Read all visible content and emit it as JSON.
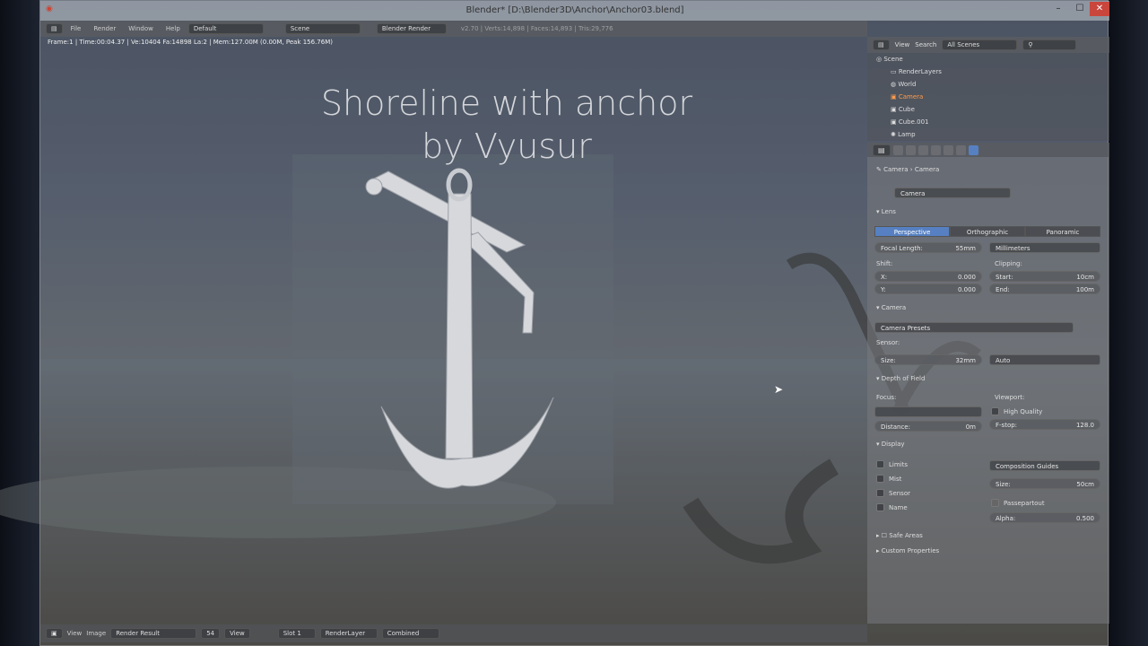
{
  "window": {
    "title": "Blender* [D:\\Blender3D\\Anchor\\Anchor03.blend]",
    "controls": [
      "–",
      "☐",
      "✕"
    ]
  },
  "menubar": {
    "menus": [
      "File",
      "Render",
      "Window",
      "Help"
    ],
    "layout": "Default",
    "scene": "Scene",
    "engine": "Blender Render",
    "stats": "v2.70 | Verts:14,898 | Faces:14,893 | Tris:29,776"
  },
  "viewport": {
    "info": "Frame:1 | Time:00:04.37 | Ve:10404 Fa:14898 La:2 | Mem:127.00M (0.00M, Peak 156.76M)",
    "overlay_line1": "Shoreline with anchor",
    "overlay_line2": "by Vyusur"
  },
  "bottombar": {
    "view": "View",
    "image": "Image",
    "image_name": "Render Result",
    "frame_num": "54",
    "view2": "View",
    "slot": "Slot 1",
    "layer": "RenderLayer",
    "pass": "Combined"
  },
  "outliner": {
    "view": "View",
    "search": "Search",
    "filter": "All Scenes",
    "items": [
      {
        "name": "Scene"
      },
      {
        "name": "RenderLayers"
      },
      {
        "name": "World"
      },
      {
        "name": "Camera"
      },
      {
        "name": "Cube"
      },
      {
        "name": "Cube.001"
      },
      {
        "name": "Lamp"
      }
    ]
  },
  "properties": {
    "breadcrumb": [
      "Camera",
      "Camera"
    ],
    "datablock": "Camera",
    "lens": {
      "header": "Lens",
      "tabs": [
        "Perspective",
        "Orthographic",
        "Panoramic"
      ],
      "active_tab": "Perspective",
      "focal_label": "Focal Length:",
      "focal_value": "55mm",
      "units": "Millimeters",
      "shift_label": "Shift:",
      "clipping_label": "Clipping:",
      "shift_x_label": "X:",
      "shift_x": "0.000",
      "shift_y_label": "Y:",
      "shift_y": "0.000",
      "clip_start_label": "Start:",
      "clip_start": "10cm",
      "clip_end_label": "End:",
      "clip_end": "100m"
    },
    "camera": {
      "header": "Camera",
      "presets": "Camera Presets",
      "sensor_label": "Sensor:",
      "size_label": "Size:",
      "size_value": "32mm",
      "fit": "Auto"
    },
    "dof": {
      "header": "Depth of Field",
      "focus_label": "Focus:",
      "viewport_label": "Viewport:",
      "hq": "High Quality",
      "distance_label": "Distance:",
      "distance_value": "0m",
      "fstop_label": "F-stop:",
      "fstop_value": "128.0"
    },
    "display": {
      "header": "Display",
      "checks": [
        "Limits",
        "Mist",
        "Sensor",
        "Name"
      ],
      "guides": "Composition Guides",
      "size_label": "Size:",
      "size_value": "50cm",
      "passepartout": "Passepartout",
      "alpha_label": "Alpha:",
      "alpha_value": "0.500"
    },
    "safe_areas": "Safe Areas",
    "custom": "Custom Properties"
  }
}
